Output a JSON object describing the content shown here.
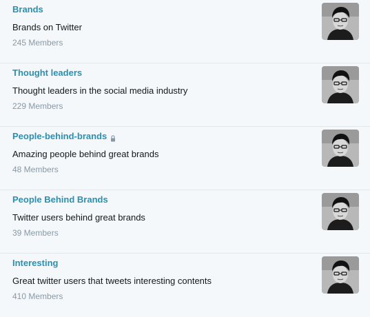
{
  "lists": [
    {
      "name": "Brands",
      "description": "Brands on Twitter",
      "members": "245 Members",
      "private": false
    },
    {
      "name": "Thought leaders",
      "description": "Thought leaders in the social media industry",
      "members": "229 Members",
      "private": false
    },
    {
      "name": "People-behind-brands",
      "description": "Amazing people behind great brands",
      "members": "48 Members",
      "private": true
    },
    {
      "name": "People Behind Brands",
      "description": "Twitter users behind great brands",
      "members": "39 Members",
      "private": false
    },
    {
      "name": "Interesting",
      "description": "Great twitter users that tweets interesting contents",
      "members": "410 Members",
      "private": false
    }
  ],
  "colors": {
    "link": "#2a8fb0",
    "meta": "#8899a6",
    "text": "#14171a",
    "background": "#f5f8fa"
  }
}
